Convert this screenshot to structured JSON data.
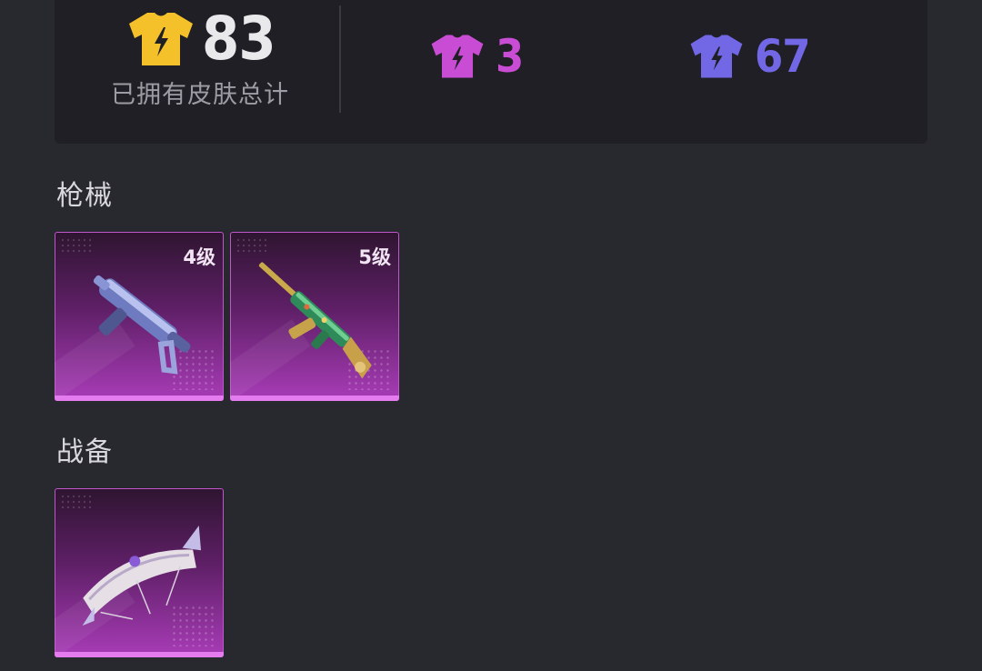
{
  "stats": {
    "total_count": "83",
    "total_label": "已拥有皮肤总计",
    "purple_count": "3",
    "violet_count": "67",
    "colors": {
      "gold": "#f5c12a",
      "purple": "#c94cd4",
      "violet": "#7268e6"
    },
    "icons": [
      "gold-shirt-icon",
      "purple-shirt-icon",
      "violet-shirt-icon"
    ]
  },
  "sections": [
    {
      "title": "枪械",
      "items": [
        {
          "level": "4级",
          "icon": "smg-skin"
        },
        {
          "level": "5级",
          "icon": "rifle-skin"
        }
      ]
    },
    {
      "title": "战备",
      "items": [
        {
          "level": "",
          "icon": "parachute-skin"
        }
      ]
    }
  ]
}
